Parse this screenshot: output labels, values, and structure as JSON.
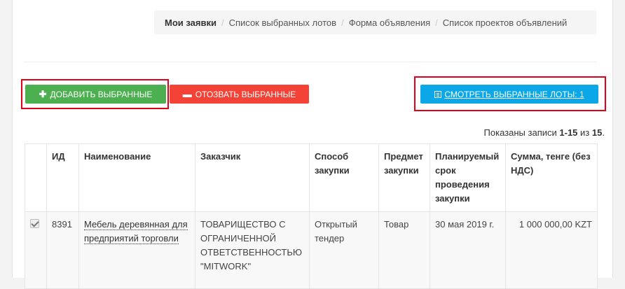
{
  "breadcrumb": {
    "items": [
      {
        "label": "Мои заявки",
        "active": true
      },
      {
        "label": "Список выбранных лотов",
        "active": false
      },
      {
        "label": "Форма объявления",
        "active": false
      },
      {
        "label": "Список проектов объявлений",
        "active": false
      }
    ],
    "separator": "/"
  },
  "toolbar": {
    "add_label": "ДОБАВИТЬ ВЫБРАННЫЕ",
    "revoke_label": "ОТОЗВАТЬ ВЫБРАННЫЕ",
    "view_label": "СМОТРЕТЬ ВЫБРАННЫЕ ЛОТЫ: 1",
    "add_icon": "plus-icon",
    "revoke_icon": "minus-icon",
    "view_icon": "list-icon",
    "colors": {
      "add": "#4caf50",
      "revoke": "#f44336",
      "view": "#0ba7e6",
      "highlight": "#e0001a"
    }
  },
  "records": {
    "prefix": "Показаны записи",
    "range": "1-15",
    "of": "из",
    "total": "15",
    "suffix": "."
  },
  "table": {
    "columns": [
      "",
      "ИД",
      "Наименование",
      "Заказчик",
      "Способ закупки",
      "Предмет закупки",
      "Планируемый срок проведения закупки",
      "Сумма, тенге (без НДС)"
    ],
    "rows": [
      {
        "checked": true,
        "id": "8391",
        "name": "Мебель деревянная для предприятий торговли",
        "customer": "ТОВАРИЩЕСТВО С ОГРАНИЧЕННОЙ ОТВЕТСТВЕННОСТЬЮ \"MITWORK\"",
        "method": "Открытый тендер",
        "subject": "Товар",
        "date": "30 мая 2019 г.",
        "sum": "1 000 000,00 KZT"
      }
    ]
  }
}
